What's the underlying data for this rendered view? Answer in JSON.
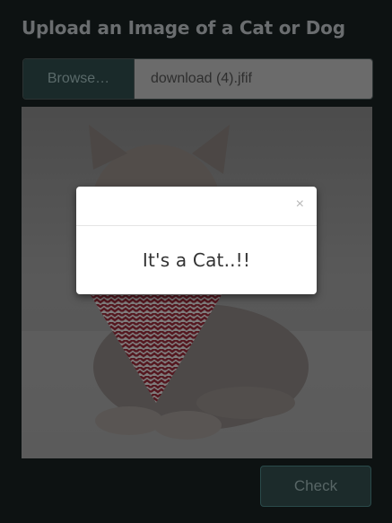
{
  "page": {
    "title": "Upload an Image of a Cat or Dog"
  },
  "upload": {
    "browse_label": "Browse…",
    "file_name": "download (4).jfif"
  },
  "preview": {
    "subject_icon": "cat-photo"
  },
  "modal": {
    "close_label": "×",
    "message": "It's a Cat..!!"
  },
  "actions": {
    "check_label": "Check"
  },
  "colors": {
    "background": "#0d1212",
    "button_bg": "#1c2b2b",
    "modal_bg": "#ffffff"
  }
}
